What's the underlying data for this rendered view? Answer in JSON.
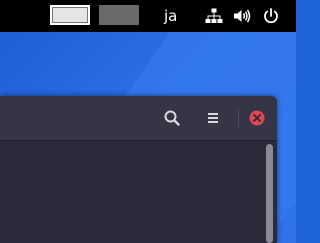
{
  "topbar": {
    "workspaces": [
      "workspace-1",
      "workspace-2"
    ],
    "active_workspace": 1,
    "language": "ja",
    "icons": [
      "network-icon",
      "volume-icon",
      "power-icon"
    ]
  },
  "window": {
    "toolbar_icons": [
      "search-icon",
      "menu-icon",
      "close-icon"
    ],
    "close_color": "#e0464f"
  },
  "colors": {
    "desktop": "#2c6fe6",
    "titlebar": "#353546",
    "content": "#2b2a3b"
  }
}
